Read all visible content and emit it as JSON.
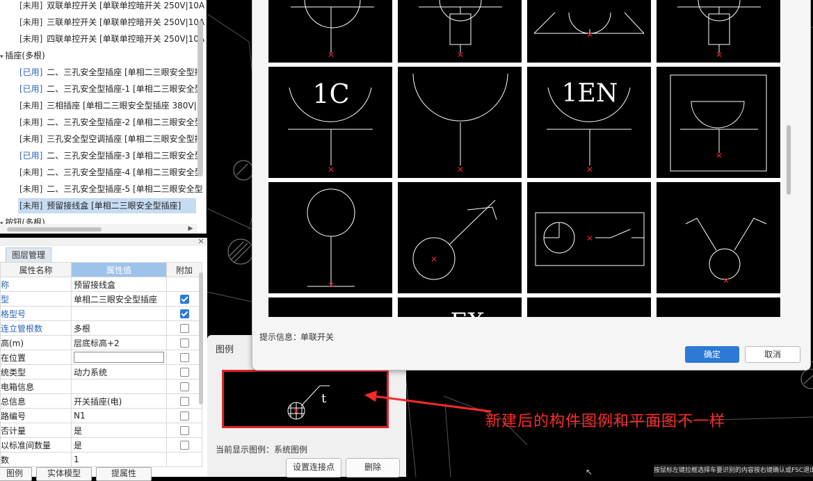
{
  "tree": {
    "items": [
      {
        "tag": "[未用]",
        "text": " 双联单控开关 [单联单控暗开关 250V|10A",
        "used": false,
        "indent": 28
      },
      {
        "tag": "[未用]",
        "text": " 三联单控开关 [单联单控暗开关 250V|10A",
        "used": false,
        "indent": 28
      },
      {
        "tag": "[未用]",
        "text": " 四联单控开关 [单联单控暗开关 250V|10A",
        "used": false,
        "indent": 28
      },
      {
        "tag": "",
        "text": "插座(多根)",
        "used": false,
        "indent": 8,
        "group": true
      },
      {
        "tag": "[已用]",
        "text": " 二、三孔安全型插座 [单相二三眼安全型插",
        "used": true,
        "indent": 28
      },
      {
        "tag": "[已用]",
        "text": " 二、三孔安全型插座-1 [单相二三眼安全型",
        "used": true,
        "indent": 28
      },
      {
        "tag": "[未用]",
        "text": " 三相插座 [单相二三眼安全型插座 380V|1",
        "used": false,
        "indent": 28
      },
      {
        "tag": "[未用]",
        "text": " 二、三孔安全型插座-2 [单相二三眼安全型",
        "used": false,
        "indent": 28
      },
      {
        "tag": "[未用]",
        "text": " 三孔安全型空调插座 [单相二三眼安全型插",
        "used": false,
        "indent": 28
      },
      {
        "tag": "[已用]",
        "text": " 二、三孔安全型插座-3 [单相二三眼安全型",
        "used": true,
        "indent": 28
      },
      {
        "tag": "[未用]",
        "text": " 二、三孔安全型插座-4 [单相二三眼安全型",
        "used": false,
        "indent": 28
      },
      {
        "tag": "[未用]",
        "text": " 二、三孔安全型插座-5 [单相二三眼安全型",
        "used": false,
        "indent": 28
      },
      {
        "tag": "[未用]",
        "text": " 预留接线盒 [单相二三眼安全型插座]",
        "used": false,
        "indent": 28,
        "selected": true
      },
      {
        "tag": "",
        "text": "按钮(多根)",
        "used": false,
        "indent": 8,
        "group": true
      }
    ]
  },
  "props": {
    "tab": "图层管理",
    "headers": {
      "name": "属性名称",
      "value": "属性值",
      "extra": "附加"
    },
    "rows": [
      {
        "name": "名称",
        "value": "预留接线盒",
        "check": null,
        "blue": true
      },
      {
        "name": "类型",
        "value": "单相二三眼安全型插座",
        "check": true,
        "blue": true
      },
      {
        "name": "规格型号",
        "value": "",
        "check": true,
        "blue": true
      },
      {
        "name": "可连立管根数",
        "value": "多根",
        "check": false,
        "blue": true
      },
      {
        "name": "标高(m)",
        "value": "层底标高+2",
        "check": false,
        "blue": false
      },
      {
        "name": "所在位置",
        "value": "",
        "check": false,
        "blue": false,
        "edit": true
      },
      {
        "name": "系统类型",
        "value": "动力系统",
        "check": false,
        "blue": false
      },
      {
        "name": "配电箱信息",
        "value": "",
        "check": false,
        "blue": false
      },
      {
        "name": "汇总信息",
        "value": "开关插座(电)",
        "check": false,
        "blue": false
      },
      {
        "name": "回路编号",
        "value": "N1",
        "check": false,
        "blue": false
      },
      {
        "name": "是否计量",
        "value": "是",
        "check": false,
        "blue": false
      },
      {
        "name": "乘以标准间数量",
        "value": "是",
        "check": false,
        "blue": false
      },
      {
        "name": "倍数",
        "value": "1",
        "check": null,
        "blue": false
      }
    ],
    "bottom_buttons": [
      "图例",
      "实体模型",
      "提属性"
    ]
  },
  "legend": {
    "title": "图例",
    "current_label": "当前显示图例：系统图例",
    "btn_connect": "设置连接点",
    "btn_delete": "删除",
    "preview_text": "t"
  },
  "dialog": {
    "hint_label": "提示信息：",
    "hint_value": "单联开关",
    "ok": "确定",
    "cancel": "取消",
    "cell_texts": {
      "c1": "1C",
      "c3": "1EN",
      "partial": "EX"
    }
  },
  "annotation": "新建后的构件图例和平面图不一样",
  "status_text": "按鼠标左键拉框选择车要识别的内容按右键确认或FSC退出",
  "colors": {
    "accent": "#2d7ad6",
    "annotation": "#ff2a2a",
    "marker": "#e0222a"
  }
}
